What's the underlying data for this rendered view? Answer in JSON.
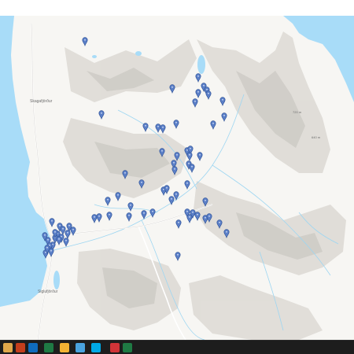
{
  "map": {
    "labels": [
      {
        "id": "town-1",
        "text": "Skagafjörður"
      },
      {
        "id": "town-2",
        "text": "Siglufjörður"
      },
      {
        "id": "elev-1",
        "text": "720 m"
      },
      {
        "id": "elev-2",
        "text": "640 m"
      }
    ],
    "colors": {
      "water": "#a8dcf8",
      "land": "#f7f6f3",
      "shade": "#d9d7d3",
      "river": "#9dd6f2",
      "road": "#ffffff",
      "marker": "#5b7fc7",
      "marker_dark": "#2b4f94"
    },
    "marker_count": 72
  },
  "taskbar": {
    "apps": [
      {
        "name": "start-icon",
        "color": "#e0a84a"
      },
      {
        "name": "powerpoint-icon",
        "color": "#c43e1c"
      },
      {
        "name": "outlook-icon",
        "color": "#0f6cbd"
      },
      {
        "name": "excel-icon",
        "color": "#1f7a44"
      },
      {
        "name": "app-yellow-icon",
        "color": "#f2b233"
      },
      {
        "name": "browser-icon",
        "color": "#4aa3df"
      },
      {
        "name": "skype-icon",
        "color": "#00a9e6"
      },
      {
        "name": "app-red-icon",
        "color": "#d13438"
      },
      {
        "name": "excel-icon-2",
        "color": "#1f7a44"
      }
    ]
  }
}
